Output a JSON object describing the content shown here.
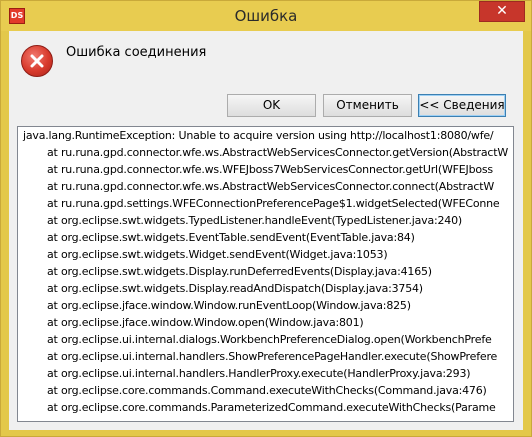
{
  "window": {
    "title": "Ошибка",
    "close_glyph": "✕",
    "app_icon_text": "DS"
  },
  "message": "Ошибка соединения",
  "buttons": {
    "ok": "OK",
    "cancel": "Отменить",
    "details": "<< Сведения"
  },
  "details": {
    "lines": [
      "java.lang.RuntimeException: Unable to acquire version using http://localhost1:8080/wfe/",
      "at ru.runa.gpd.connector.wfe.ws.AbstractWebServicesConnector.getVersion(AbstractW",
      "at ru.runa.gpd.connector.wfe.ws.WFEJboss7WebServicesConnector.getUrl(WFEJboss",
      "at ru.runa.gpd.connector.wfe.ws.AbstractWebServicesConnector.connect(AbstractW",
      "at ru.runa.gpd.settings.WFEConnectionPreferencePage$1.widgetSelected(WFEConne",
      "at org.eclipse.swt.widgets.TypedListener.handleEvent(TypedListener.java:240)",
      "at org.eclipse.swt.widgets.EventTable.sendEvent(EventTable.java:84)",
      "at org.eclipse.swt.widgets.Widget.sendEvent(Widget.java:1053)",
      "at org.eclipse.swt.widgets.Display.runDeferredEvents(Display.java:4165)",
      "at org.eclipse.swt.widgets.Display.readAndDispatch(Display.java:3754)",
      "at org.eclipse.jface.window.Window.runEventLoop(Window.java:825)",
      "at org.eclipse.jface.window.Window.open(Window.java:801)",
      "at org.eclipse.ui.internal.dialogs.WorkbenchPreferenceDialog.open(WorkbenchPrefe",
      "at org.eclipse.ui.internal.handlers.ShowPreferencePageHandler.execute(ShowPrefere",
      "at org.eclipse.ui.internal.handlers.HandlerProxy.execute(HandlerProxy.java:293)",
      "at org.eclipse.core.commands.Command.executeWithChecks(Command.java:476)",
      "at org.eclipse.core.commands.ParameterizedCommand.executeWithChecks(Parame"
    ]
  }
}
